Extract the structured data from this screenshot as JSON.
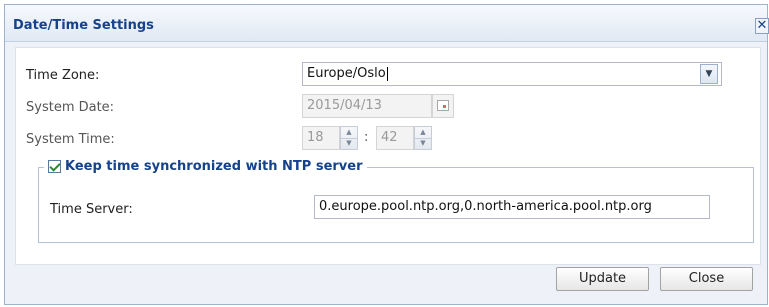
{
  "dialog": {
    "title": "Date/Time Settings",
    "close_glyph": "✕"
  },
  "form": {
    "time_zone_label": "Time Zone:",
    "time_zone_value": "Europe/Oslo",
    "system_date_label": "System Date:",
    "system_date_value": "2015/04/13",
    "system_time_label": "System Time:",
    "hour_value": "18",
    "minute_value": "42",
    "time_separator": ":"
  },
  "ntp": {
    "checkbox_label": "Keep time synchronized with NTP server",
    "checked": true,
    "time_server_label": "Time Server:",
    "time_server_value": "0.europe.pool.ntp.org,0.north-america.pool.ntp.org"
  },
  "buttons": {
    "update_label": "Update",
    "close_label": "Close"
  },
  "icons": {
    "dropdown": "chevron-down-icon",
    "calendar": "calendar-icon",
    "spinner_up": "arrow-up-icon",
    "spinner_down": "arrow-down-icon",
    "close": "close-icon",
    "check": "checkmark-icon"
  },
  "colors": {
    "title_text": "#15428b",
    "dialog_background": "#eef2f8",
    "check_mark": "#2a8a2a"
  }
}
